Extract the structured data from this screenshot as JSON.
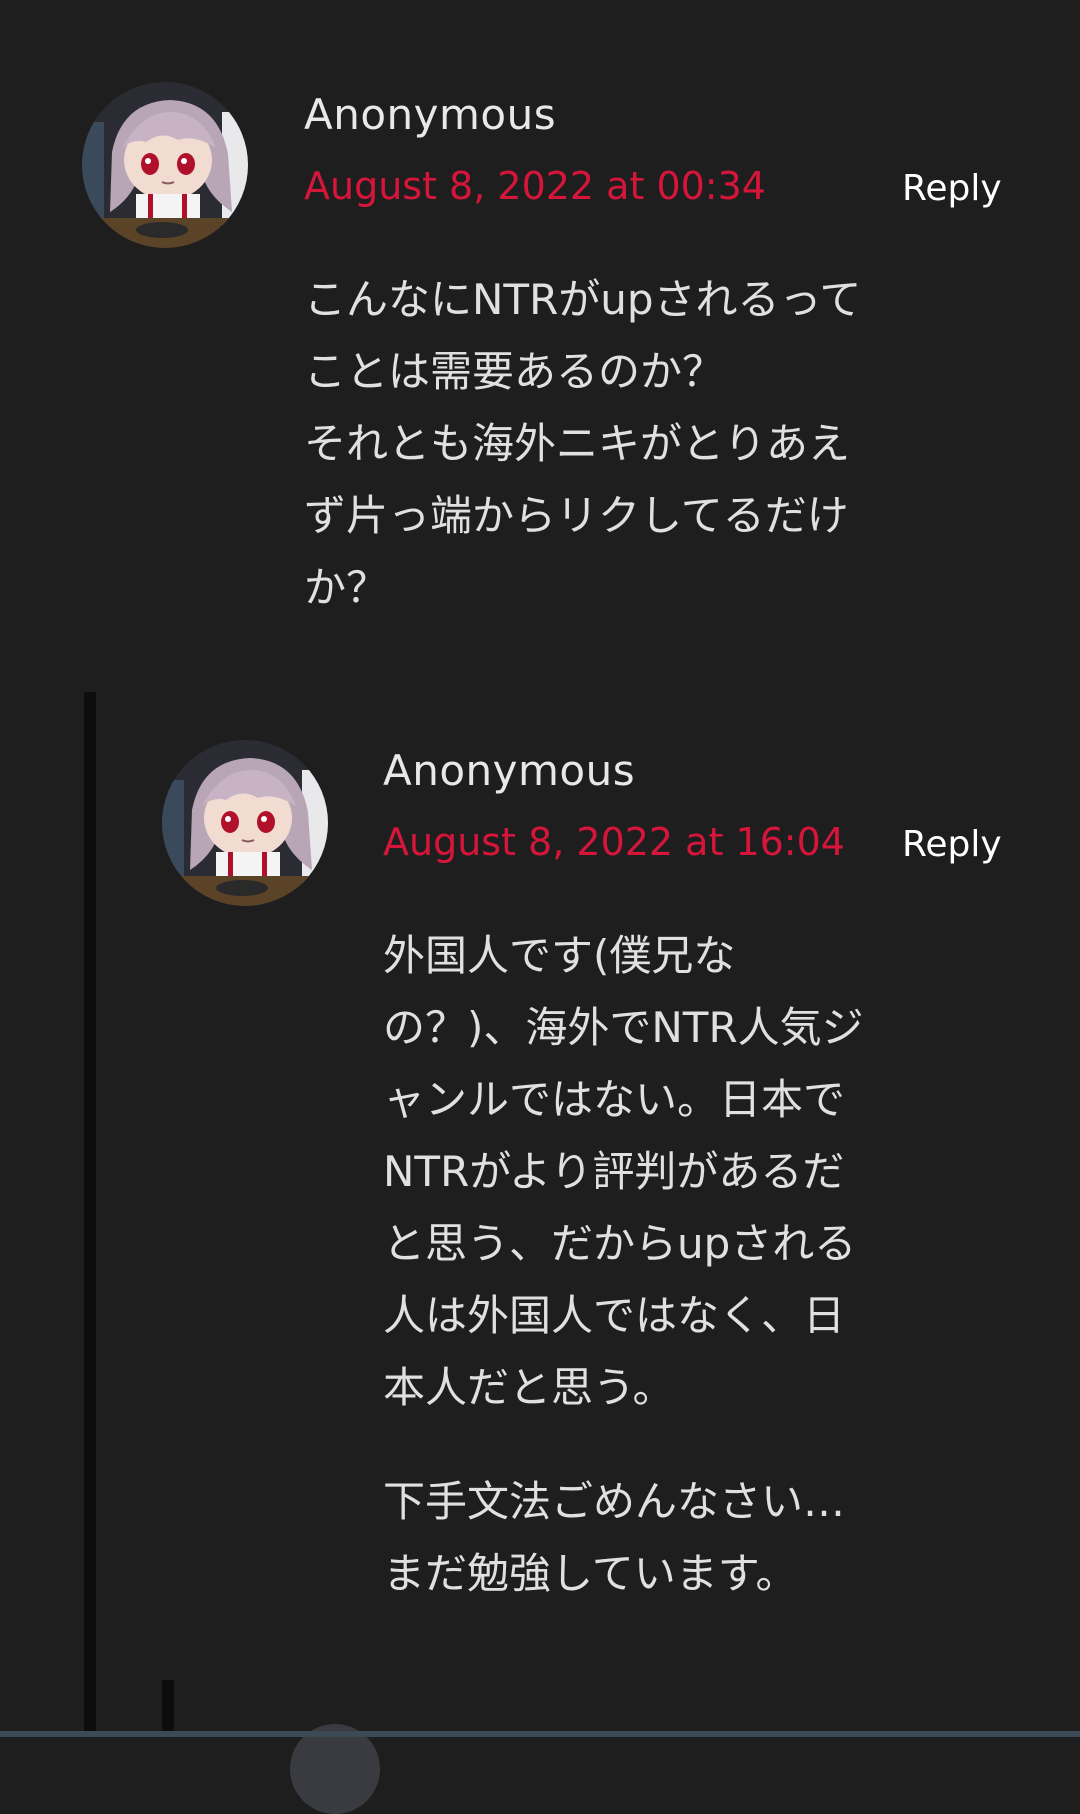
{
  "comments": [
    {
      "author": "Anonymous",
      "date": "August 8, 2022 at 00:34",
      "reply_label": "Reply",
      "avatar_icon": "anime-character-avatar",
      "lines": [
        "こんなにNTRがupされるって",
        "ことは需要あるのか？",
        "それとも海外ニキがとりあえ",
        "ず片っ端からリクしてるだけ",
        "か？"
      ]
    },
    {
      "author": "Anonymous",
      "date": "August 8, 2022 at 16:04",
      "reply_label": "Reply",
      "avatar_icon": "anime-character-avatar",
      "paragraph1_lines": [
        "外国人です(僕兄な",
        "の？)、海外でNTR人気ジ",
        "ャンルではない。日本で",
        "NTRがより評判があるだ",
        "と思う、だからupされる",
        "人は外国人ではなく、日",
        "本人だと思う。"
      ],
      "paragraph2_lines": [
        "下手文法ごめんなさい…",
        "まだ勉強しています。"
      ]
    }
  ],
  "colors": {
    "background": "#1e1e1f",
    "date": "#d6153a",
    "thread_line": "#0d0d0d"
  }
}
